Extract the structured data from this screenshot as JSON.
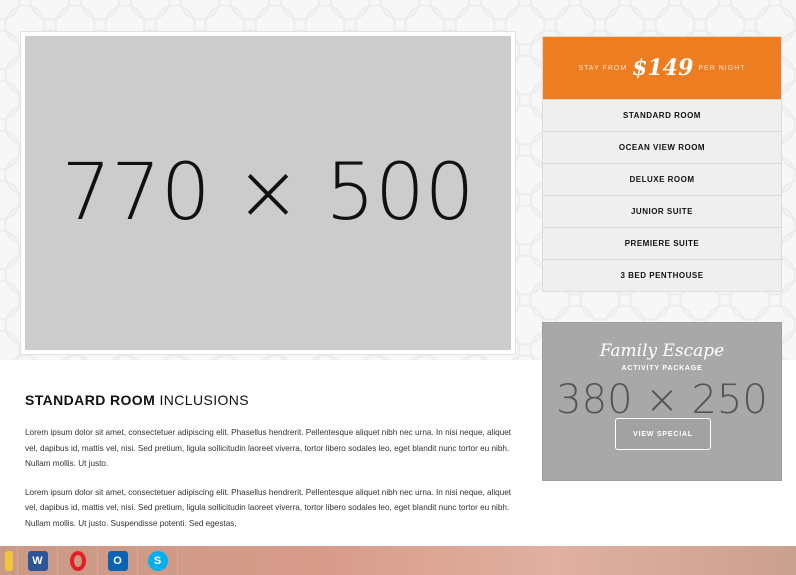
{
  "hero": {
    "placeholder_text": "770 × 500"
  },
  "pricebox": {
    "prefix": "STAY FROM",
    "price": "$149",
    "suffix": "PER NIGHT",
    "rooms": [
      "STANDARD ROOM",
      "OCEAN VIEW ROOM",
      "DELUXE ROOM",
      "JUNIOR SUITE",
      "PREMIERE SUITE",
      "3 BED PENTHOUSE"
    ],
    "accent_color": "#ee7d22"
  },
  "special": {
    "title": "Family Escape",
    "subtitle": "ACTIVITY PACKAGE",
    "placeholder_text": "380 × 250",
    "button_label": "VIEW SPECIAL"
  },
  "inclusions": {
    "heading_bold": "STANDARD ROOM",
    "heading_rest": "INCLUSIONS",
    "paragraphs": [
      "Lorem ipsum dolor sit amet, consectetuer adipiscing elit. Phasellus hendrerit. Pellentesque aliquet nibh nec urna. In nisi neque, aliquet vel, dapibus id, mattis vel, nisi. Sed pretium, ligula sollicitudin laoreet viverra, tortor libero sodales leo, eget blandit nunc tortor eu nibh. Nullam mollis. Ut justo.",
      "Lorem ipsum dolor sit amet, consectetuer adipiscing elit. Phasellus hendrerit. Pellentesque aliquet nibh nec urna. In nisi neque, aliquet vel, dapibus id, mattis vel, nisi. Sed pretium, ligula sollicitudin laoreet viverra, tortor libero sodales leo, eget blandit nunc tortor eu nibh. Nullam mollis. Ut justo. Suspendisse potenti. Sed egestas,"
    ]
  },
  "taskbar": {
    "apps": [
      "edge-icon",
      "word-icon",
      "opera-icon",
      "outlook-icon",
      "skype-icon"
    ],
    "word_glyph": "W",
    "outlook_glyph": "O",
    "skype_glyph": "S"
  }
}
